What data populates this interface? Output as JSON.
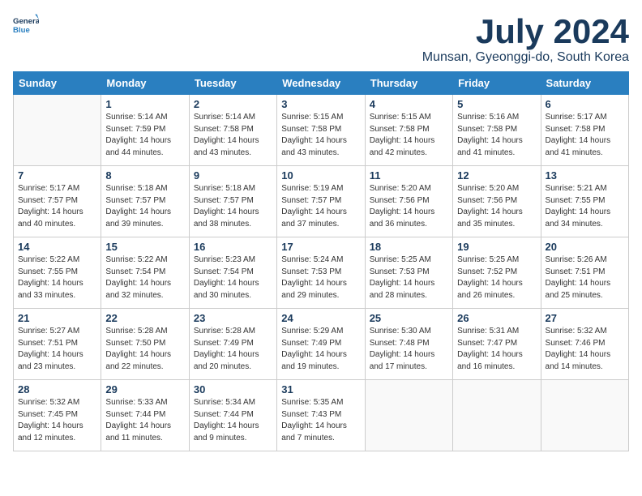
{
  "header": {
    "logo_line1": "General",
    "logo_line2": "Blue",
    "month_title": "July 2024",
    "location": "Munsan, Gyeonggi-do, South Korea"
  },
  "weekdays": [
    "Sunday",
    "Monday",
    "Tuesday",
    "Wednesday",
    "Thursday",
    "Friday",
    "Saturday"
  ],
  "weeks": [
    [
      {
        "day": "",
        "sunrise": "",
        "sunset": "",
        "daylight": ""
      },
      {
        "day": "1",
        "sunrise": "5:14 AM",
        "sunset": "7:59 PM",
        "daylight": "14 hours and 44 minutes."
      },
      {
        "day": "2",
        "sunrise": "5:14 AM",
        "sunset": "7:58 PM",
        "daylight": "14 hours and 43 minutes."
      },
      {
        "day": "3",
        "sunrise": "5:15 AM",
        "sunset": "7:58 PM",
        "daylight": "14 hours and 43 minutes."
      },
      {
        "day": "4",
        "sunrise": "5:15 AM",
        "sunset": "7:58 PM",
        "daylight": "14 hours and 42 minutes."
      },
      {
        "day": "5",
        "sunrise": "5:16 AM",
        "sunset": "7:58 PM",
        "daylight": "14 hours and 41 minutes."
      },
      {
        "day": "6",
        "sunrise": "5:17 AM",
        "sunset": "7:58 PM",
        "daylight": "14 hours and 41 minutes."
      }
    ],
    [
      {
        "day": "7",
        "sunrise": "5:17 AM",
        "sunset": "7:57 PM",
        "daylight": "14 hours and 40 minutes."
      },
      {
        "day": "8",
        "sunrise": "5:18 AM",
        "sunset": "7:57 PM",
        "daylight": "14 hours and 39 minutes."
      },
      {
        "day": "9",
        "sunrise": "5:18 AM",
        "sunset": "7:57 PM",
        "daylight": "14 hours and 38 minutes."
      },
      {
        "day": "10",
        "sunrise": "5:19 AM",
        "sunset": "7:57 PM",
        "daylight": "14 hours and 37 minutes."
      },
      {
        "day": "11",
        "sunrise": "5:20 AM",
        "sunset": "7:56 PM",
        "daylight": "14 hours and 36 minutes."
      },
      {
        "day": "12",
        "sunrise": "5:20 AM",
        "sunset": "7:56 PM",
        "daylight": "14 hours and 35 minutes."
      },
      {
        "day": "13",
        "sunrise": "5:21 AM",
        "sunset": "7:55 PM",
        "daylight": "14 hours and 34 minutes."
      }
    ],
    [
      {
        "day": "14",
        "sunrise": "5:22 AM",
        "sunset": "7:55 PM",
        "daylight": "14 hours and 33 minutes."
      },
      {
        "day": "15",
        "sunrise": "5:22 AM",
        "sunset": "7:54 PM",
        "daylight": "14 hours and 32 minutes."
      },
      {
        "day": "16",
        "sunrise": "5:23 AM",
        "sunset": "7:54 PM",
        "daylight": "14 hours and 30 minutes."
      },
      {
        "day": "17",
        "sunrise": "5:24 AM",
        "sunset": "7:53 PM",
        "daylight": "14 hours and 29 minutes."
      },
      {
        "day": "18",
        "sunrise": "5:25 AM",
        "sunset": "7:53 PM",
        "daylight": "14 hours and 28 minutes."
      },
      {
        "day": "19",
        "sunrise": "5:25 AM",
        "sunset": "7:52 PM",
        "daylight": "14 hours and 26 minutes."
      },
      {
        "day": "20",
        "sunrise": "5:26 AM",
        "sunset": "7:51 PM",
        "daylight": "14 hours and 25 minutes."
      }
    ],
    [
      {
        "day": "21",
        "sunrise": "5:27 AM",
        "sunset": "7:51 PM",
        "daylight": "14 hours and 23 minutes."
      },
      {
        "day": "22",
        "sunrise": "5:28 AM",
        "sunset": "7:50 PM",
        "daylight": "14 hours and 22 minutes."
      },
      {
        "day": "23",
        "sunrise": "5:28 AM",
        "sunset": "7:49 PM",
        "daylight": "14 hours and 20 minutes."
      },
      {
        "day": "24",
        "sunrise": "5:29 AM",
        "sunset": "7:49 PM",
        "daylight": "14 hours and 19 minutes."
      },
      {
        "day": "25",
        "sunrise": "5:30 AM",
        "sunset": "7:48 PM",
        "daylight": "14 hours and 17 minutes."
      },
      {
        "day": "26",
        "sunrise": "5:31 AM",
        "sunset": "7:47 PM",
        "daylight": "14 hours and 16 minutes."
      },
      {
        "day": "27",
        "sunrise": "5:32 AM",
        "sunset": "7:46 PM",
        "daylight": "14 hours and 14 minutes."
      }
    ],
    [
      {
        "day": "28",
        "sunrise": "5:32 AM",
        "sunset": "7:45 PM",
        "daylight": "14 hours and 12 minutes."
      },
      {
        "day": "29",
        "sunrise": "5:33 AM",
        "sunset": "7:44 PM",
        "daylight": "14 hours and 11 minutes."
      },
      {
        "day": "30",
        "sunrise": "5:34 AM",
        "sunset": "7:44 PM",
        "daylight": "14 hours and 9 minutes."
      },
      {
        "day": "31",
        "sunrise": "5:35 AM",
        "sunset": "7:43 PM",
        "daylight": "14 hours and 7 minutes."
      },
      {
        "day": "",
        "sunrise": "",
        "sunset": "",
        "daylight": ""
      },
      {
        "day": "",
        "sunrise": "",
        "sunset": "",
        "daylight": ""
      },
      {
        "day": "",
        "sunrise": "",
        "sunset": "",
        "daylight": ""
      }
    ]
  ]
}
